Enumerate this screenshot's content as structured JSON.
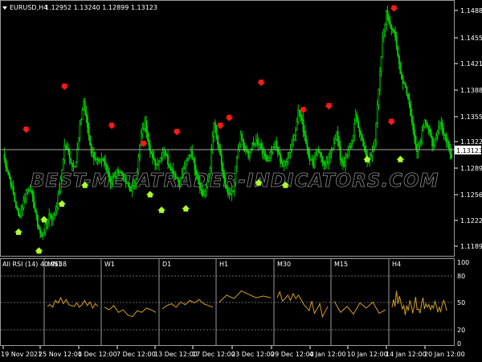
{
  "chart_header": {
    "symbol_label": "EURUSD,H4",
    "ohlc": "1.12952 1.13240 1.12899 1.13123",
    "collapse_icon": "triangle-down-icon"
  },
  "price_axis": {
    "ticks": [
      "1.14880",
      "1.14550",
      "1.14215",
      "1.13885",
      "1.13555",
      "1.13220",
      "1.12890",
      "1.12560",
      "1.12225",
      "1.11895"
    ],
    "current_price": "1.13123"
  },
  "watermark": "BEST-METATRADER-INDICATORS.COM",
  "indicator": {
    "label": "All RSI (14) 40.9538",
    "timeframes": [
      "MN1",
      "W1",
      "D1",
      "H1",
      "M30",
      "M15",
      "H4"
    ],
    "levels": [
      "100",
      "80",
      "50",
      "20",
      "0"
    ]
  },
  "time_axis": [
    "19 Nov 2021",
    "25 Nov 12:00",
    "1 Dec 12:00",
    "7 Dec 12:00",
    "13 Dec 12:00",
    "17 Dec 12:00",
    "23 Dec 12:00",
    "29 Dec 12:00",
    "4 Jan 12:00",
    "10 Jan 12:00",
    "14 Jan 12:00",
    "20 Jan 12:00"
  ],
  "colors": {
    "background": "#000000",
    "candles": "#00d000",
    "rsi_line": "#d4a017",
    "sell_arrow": "#ff1a1a",
    "buy_arrow": "#adff2f",
    "grid": "#808080"
  },
  "chart_data": [
    {
      "type": "candlestick",
      "title": "EURUSD,H4",
      "ylim": [
        1.1175,
        1.1498
      ],
      "close_path": [
        1.1305,
        1.1285,
        1.1268,
        1.1245,
        1.1225,
        1.1238,
        1.1258,
        1.1262,
        1.124,
        1.1215,
        1.1198,
        1.1212,
        1.1228,
        1.1222,
        1.124,
        1.127,
        1.1315,
        1.1308,
        1.129,
        1.1295,
        1.134,
        1.1372,
        1.134,
        1.1308,
        1.13,
        1.1292,
        1.1298,
        1.1288,
        1.127,
        1.1275,
        1.1285,
        1.128,
        1.1268,
        1.126,
        1.1262,
        1.1285,
        1.133,
        1.1345,
        1.132,
        1.1298,
        1.1292,
        1.13,
        1.1312,
        1.1295,
        1.1285,
        1.1278,
        1.1268,
        1.1285,
        1.1298,
        1.131,
        1.1288,
        1.127,
        1.1252,
        1.126,
        1.129,
        1.1345,
        1.1318,
        1.1292,
        1.1262,
        1.125,
        1.1258,
        1.13,
        1.1328,
        1.131,
        1.1305,
        1.1315,
        1.1322,
        1.1318,
        1.1305,
        1.1298,
        1.131,
        1.1318,
        1.1302,
        1.129,
        1.1298,
        1.1312,
        1.133,
        1.136,
        1.1345,
        1.1322,
        1.13,
        1.1292,
        1.1312,
        1.1302,
        1.1288,
        1.1298,
        1.1316,
        1.1332,
        1.13,
        1.1292,
        1.1308,
        1.1322,
        1.1352,
        1.1335,
        1.1318,
        1.1295,
        1.1302,
        1.1325,
        1.1385,
        1.1452,
        1.1485,
        1.1472,
        1.1462,
        1.143,
        1.1402,
        1.1392,
        1.1368,
        1.1335,
        1.1312,
        1.1325,
        1.1352,
        1.1335,
        1.1318,
        1.1325,
        1.1345,
        1.1332,
        1.132,
        1.13
      ],
      "sell_arrows": [
        1.133,
        1.1385,
        1.1335,
        1.1312,
        1.1327,
        1.1335,
        1.1345,
        1.139,
        1.1355,
        1.136,
        1.134,
        1.1485
      ],
      "buy_arrows": [
        1.1212,
        1.1188,
        1.1228,
        1.1248,
        1.1272,
        1.126,
        1.124,
        1.1242,
        1.1275,
        1.1272,
        1.1305,
        1.1305
      ]
    },
    {
      "type": "line",
      "title": "All RSI (14) 40.9538",
      "ylim": [
        0,
        100
      ],
      "levels": [
        80,
        50,
        20
      ],
      "series": [
        {
          "values": [
            45,
            47,
            44,
            52,
            49,
            55,
            48,
            53,
            47,
            46
          ]
        },
        {
          "values": [
            45,
            49,
            44,
            47,
            52,
            46,
            50,
            43,
            48,
            45
          ]
        },
        {
          "values": [
            44,
            41,
            46,
            38,
            41,
            35,
            33,
            40,
            38,
            43,
            41,
            38
          ]
        },
        {
          "values": [
            42,
            46,
            48,
            44,
            50,
            47,
            52,
            49,
            53,
            48,
            46,
            44
          ]
        },
        {
          "values": [
            50,
            58,
            54,
            63,
            59,
            55,
            57,
            55
          ]
        },
        {
          "values": [
            55,
            62,
            51,
            54,
            58,
            52,
            60,
            54,
            58,
            53
          ]
        },
        {
          "values": [
            47,
            44,
            40,
            51,
            37,
            42,
            48,
            33,
            39,
            45
          ]
        },
        {
          "values": [
            51,
            38,
            45,
            36,
            49,
            43,
            50,
            37,
            41
          ]
        },
        {
          "values": [
            44,
            53,
            45,
            63,
            48,
            57,
            50,
            42,
            46,
            35
          ]
        },
        {
          "values": [
            46,
            40,
            52,
            47,
            37,
            45,
            56,
            41,
            42,
            37,
            49,
            55
          ]
        },
        {
          "values": [
            42,
            48,
            44,
            47,
            41,
            46,
            43,
            51,
            46,
            38,
            44,
            39,
            47,
            52,
            47,
            40
          ]
        }
      ]
    }
  ]
}
